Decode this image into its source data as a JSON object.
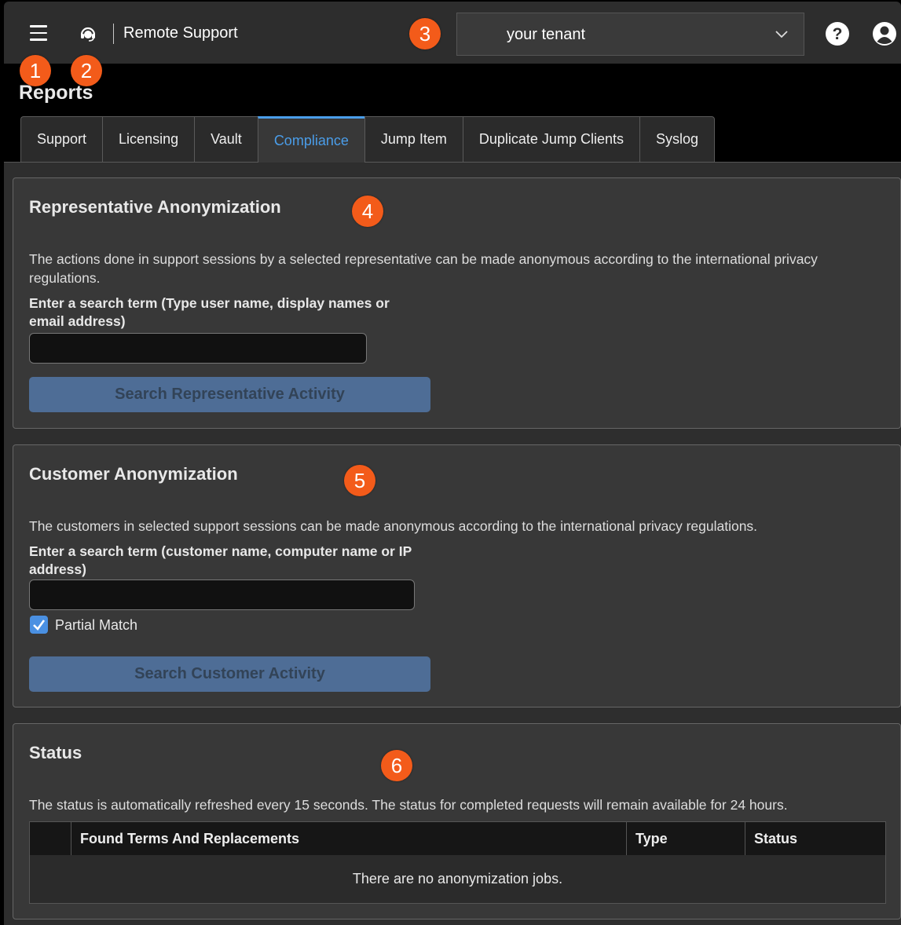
{
  "header": {
    "app_title": "Remote Support",
    "tenant_value": "your tenant",
    "menu_icon": "hamburger-menu-icon",
    "logo_icon": "headset-icon",
    "help_icon": "help-icon",
    "user_icon": "user-account-icon"
  },
  "callouts": [
    "1",
    "2",
    "3",
    "4",
    "5",
    "6"
  ],
  "page": {
    "title": "Reports"
  },
  "tabs": [
    {
      "label": "Support"
    },
    {
      "label": "Licensing"
    },
    {
      "label": "Vault"
    },
    {
      "label": "Compliance",
      "active": true
    },
    {
      "label": "Jump Item"
    },
    {
      "label": "Duplicate Jump Clients"
    },
    {
      "label": "Syslog"
    }
  ],
  "representative": {
    "title": "Representative Anonymization",
    "description": "The actions done in support sessions by a selected representative can be made anonymous according to the international privacy regulations.",
    "search_label": "Enter a search term (Type user name, display names or email address)",
    "search_value": "",
    "button_label": "Search Representative Activity"
  },
  "customer": {
    "title": "Customer Anonymization",
    "description": "The customers in selected support sessions can be made anonymous according to the international privacy regulations.",
    "search_label": "Enter a search term (customer name, computer name or IP address)",
    "search_value": "",
    "partial_match_label": "Partial Match",
    "partial_match_checked": true,
    "button_label": "Search Customer Activity"
  },
  "status": {
    "title": "Status",
    "description": "The status is automatically refreshed every 15 seconds. The status for completed requests will remain available for 24 hours.",
    "columns": [
      "",
      "Found Terms And Replacements",
      "Type",
      "Status"
    ],
    "empty_message": "There are no anonymization jobs."
  },
  "colors": {
    "accent": "#4a9de9",
    "callout": "#f35b1a",
    "button": "#4e6d96"
  }
}
